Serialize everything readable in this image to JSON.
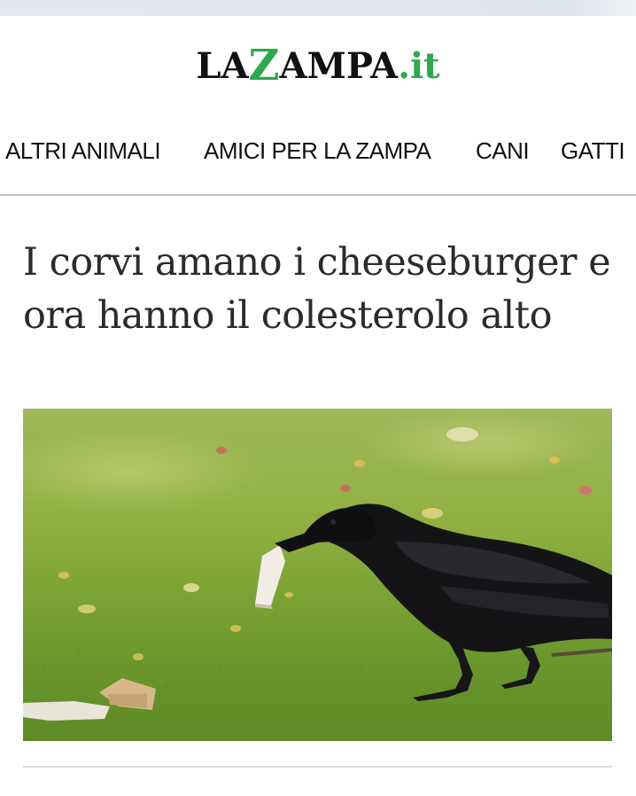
{
  "logo": {
    "part1": "LA",
    "z": "Z",
    "part2": "AMPA",
    "tld": ".it",
    "brand_green": "#2fa84f"
  },
  "nav": {
    "items": [
      "ALTRI ANIMALI",
      "AMICI PER LA ZAMPA",
      "CANI",
      "GATTI"
    ]
  },
  "article": {
    "title": "I corvi amano i cheeseburger e ora hanno il colesterolo alto"
  },
  "image": {
    "subject": "crow-with-food-on-grass"
  }
}
